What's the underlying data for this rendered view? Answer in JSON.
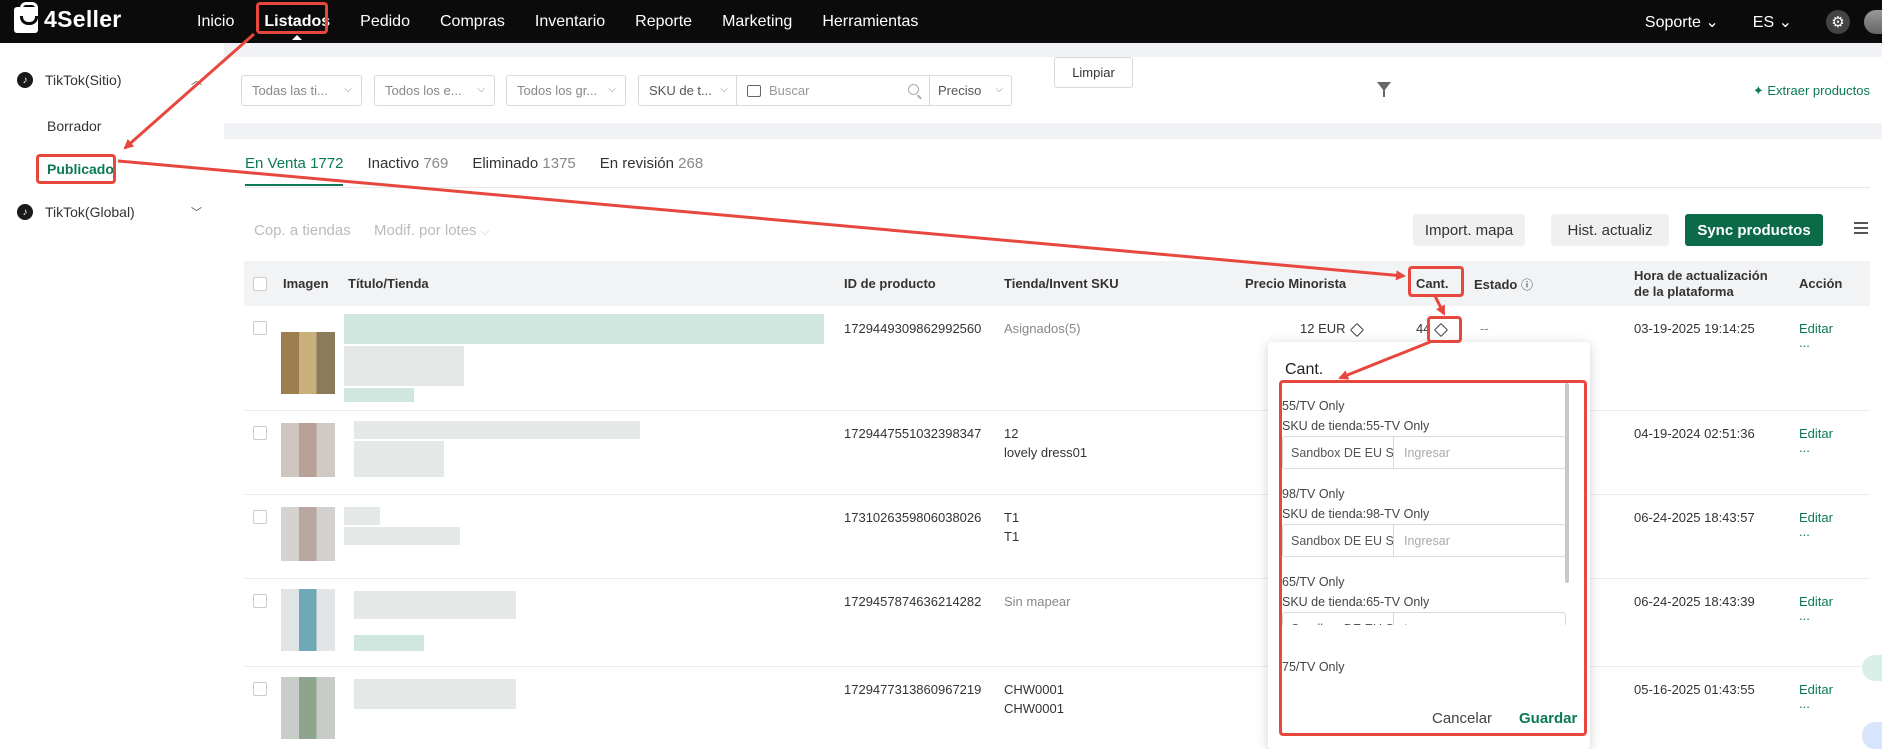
{
  "app": {
    "brand": "4Seller"
  },
  "nav": {
    "items": [
      "Inicio",
      "Listados",
      "Pedido",
      "Compras",
      "Inventario",
      "Reporte",
      "Marketing",
      "Herramientas"
    ],
    "right": {
      "support": "Soporte",
      "lang": "ES"
    }
  },
  "sidebar": {
    "group1": "TikTok(Sitio)",
    "sub1": "Borrador",
    "sub2": "Publicado",
    "group2": "TikTok(Global)"
  },
  "filters": {
    "all_types": "Todas las ti...",
    "all_states": "Todos los e...",
    "all_groups": "Todos los gr...",
    "sku_type": "SKU de t...",
    "search_placeholder": "Buscar",
    "price": "Preciso",
    "clear": "Limpiar",
    "extract": "Extraer productos"
  },
  "tabs": [
    {
      "label": "En Venta",
      "count": "1772"
    },
    {
      "label": "Inactivo",
      "count": "769"
    },
    {
      "label": "Eliminado",
      "count": "1375"
    },
    {
      "label": "En revisión",
      "count": "268"
    }
  ],
  "actions": {
    "copy": "Cop. a tiendas",
    "batch": "Modif. por lotes",
    "import": "Import. mapa",
    "history": "Hist. actualiz",
    "sync": "Sync productos"
  },
  "table": {
    "headers": {
      "image": "Imagen",
      "title": "Título/Tienda",
      "id": "ID de producto",
      "sku": "Tienda/Invent SKU",
      "price": "Precio Minorista",
      "qty": "Cant.",
      "status": "Estado",
      "updated": "Hora de actualización de la plataforma",
      "action": "Acción"
    },
    "rows": [
      {
        "id": "1729449309862992560",
        "sku1": "Asignados(5)",
        "sku2": "",
        "price": "12 EUR",
        "qty": "44",
        "status": "--",
        "updated": "03-19-2025 19:14:25",
        "edit": "Editar",
        "more": "..."
      },
      {
        "id": "1729447551032398347",
        "sku1": "12",
        "sku2": "lovely dress01",
        "updated": "04-19-2024 02:51:36",
        "edit": "Editar",
        "more": "..."
      },
      {
        "id": "1731026359806038026",
        "sku1": "T1",
        "sku2": "T1",
        "updated": "06-24-2025 18:43:57",
        "edit": "Editar",
        "more": "..."
      },
      {
        "id": "1729457874636214282",
        "sku1": "Sin mapear",
        "sku2": "",
        "updated": "06-24-2025 18:43:39",
        "edit": "Editar",
        "more": "..."
      },
      {
        "id": "1729477313860967219",
        "sku1": "CHW0001",
        "sku2": "CHW0001",
        "updated": "05-16-2025 01:43:55",
        "edit": "Editar",
        "more": "..."
      }
    ]
  },
  "popover": {
    "title": "Cant.",
    "items": [
      {
        "variant": "55/TV Only",
        "sku": "SKU de tienda:55-TV Only",
        "store": "Sandbox DE EU Sal...",
        "placeholder": "Ingresar"
      },
      {
        "variant": "98/TV Only",
        "sku": "SKU de tienda:98-TV Only",
        "store": "Sandbox DE EU Sal...",
        "placeholder": "Ingresar"
      },
      {
        "variant": "65/TV Only",
        "sku": "SKU de tienda:65-TV Only",
        "store": "Sandbox DE EU Sal...",
        "placeholder": "Ingresar"
      },
      {
        "variant": "75/TV Only"
      }
    ],
    "cancel": "Cancelar",
    "save": "Guardar"
  },
  "colors": {
    "accent": "#0b7a53",
    "annotation": "#e8473e"
  }
}
